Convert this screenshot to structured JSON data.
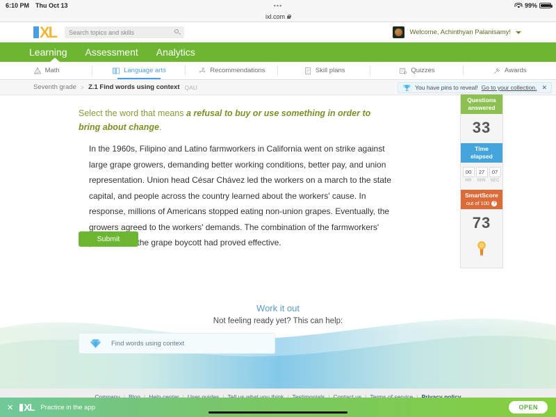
{
  "statusbar": {
    "time": "6:10 PM",
    "date": "Thu Oct 13",
    "battery": "99%"
  },
  "browser": {
    "url": "ixl.com",
    "dots": "•••"
  },
  "header": {
    "logo_i": "I",
    "logo_xl": "XL",
    "search_placeholder": "Search topics and skills",
    "welcome": "Welcome, Achinthyan Palanisamy!"
  },
  "mainnav": [
    {
      "label": "Learning",
      "active": true
    },
    {
      "label": "Assessment",
      "active": false
    },
    {
      "label": "Analytics",
      "active": false
    }
  ],
  "subjecttabs": [
    {
      "label": "Math",
      "icon": "math-icon",
      "active": false
    },
    {
      "label": "Language arts",
      "icon": "book-icon",
      "active": true
    },
    {
      "label": "Recommendations",
      "icon": "recommendations-icon",
      "active": false
    },
    {
      "label": "Skill plans",
      "icon": "skillplans-icon",
      "active": false
    },
    {
      "label": "Quizzes",
      "icon": "quizzes-icon",
      "active": false
    },
    {
      "label": "Awards",
      "icon": "awards-icon",
      "active": false
    }
  ],
  "breadcrumb": {
    "grade": "Seventh grade",
    "separator": ">",
    "skill": "Z.1 Find words using context",
    "code": "QAU"
  },
  "pins_banner": {
    "text": "You have pins to reveal!",
    "link": "Go to your collection.",
    "close": "✕"
  },
  "question": {
    "lead": "Select the word that means ",
    "emphasis": "a refusal to buy or use something in order to bring about change",
    "end": ".",
    "passage": "In the 1960s, Filipino and Latino farmworkers in California went on strike against large grape growers, demanding better working conditions, better pay, and union representation. Union head César Chávez led the workers on a march to the state capital, and people across the country learned about the workers' cause. In response, millions of Americans stopped eating non-union grapes. Eventually, the growers agreed to the workers' demands. The combination of the farmworkers' protests and the grape boycott had proved effective.",
    "submit_label": "Submit"
  },
  "panel": {
    "questions_header_l1": "Questions",
    "questions_header_l2": "answered",
    "questions_value": "33",
    "time_header_l1": "Time",
    "time_header_l2": "elapsed",
    "time": {
      "hr": "00",
      "min": "27",
      "sec": "07",
      "hr_label": "HR",
      "min_label": "MIN",
      "sec_label": "SEC"
    },
    "smartscore_header": "SmartScore",
    "smartscore_sub": "out of 100",
    "smartscore_help": "?",
    "smartscore_value": "73"
  },
  "workout": {
    "title": "Work it out",
    "subtitle": "Not feeling ready yet? This can help:",
    "card_label": "Find words using context"
  },
  "footer": {
    "links": [
      "Company",
      "Blog",
      "Help center",
      "User guides",
      "Tell us what you think",
      "Testimonials",
      "Contact us",
      "Terms of service"
    ],
    "bold_link": "Privacy policy",
    "separator": "|"
  },
  "appbanner": {
    "close": "✕",
    "logo_i": "I",
    "logo_xl": "XL",
    "label": "Practice in the app",
    "open_label": "OPEN"
  },
  "colors": {
    "brand_green": "#6cb632",
    "brand_blue": "#4a9fe0",
    "logo_yellow": "#f2b632",
    "questions_green": "#8cc152",
    "time_blue": "#43a5dc",
    "smartscore_orange": "#db6c3a",
    "question_olive": "#8a9a3a"
  }
}
